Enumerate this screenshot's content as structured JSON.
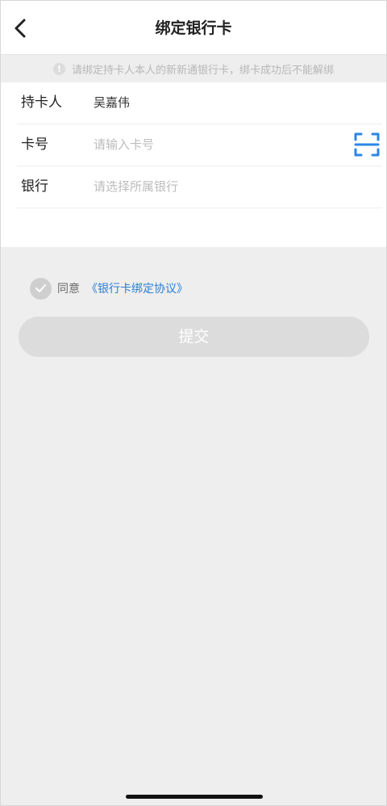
{
  "header": {
    "title": "绑定银行卡"
  },
  "notice": {
    "icon_text": "!",
    "text": "请绑定持卡人本人的新新通银行卡，绑卡成功后不能解绑"
  },
  "form": {
    "holder_label": "持卡人",
    "holder_value": "吴嘉伟",
    "card_label": "卡号",
    "card_placeholder": "请输入卡号",
    "bank_label": "银行",
    "bank_placeholder": "请选择所属银行"
  },
  "agreement": {
    "agree_text": "同意",
    "link_text": "《银行卡绑定协议》",
    "checked": true
  },
  "submit": {
    "label": "提交"
  },
  "colors": {
    "accent": "#2a7fd6",
    "scan_icon": "#2b86e6",
    "disabled_button": "#dcdcdc"
  }
}
